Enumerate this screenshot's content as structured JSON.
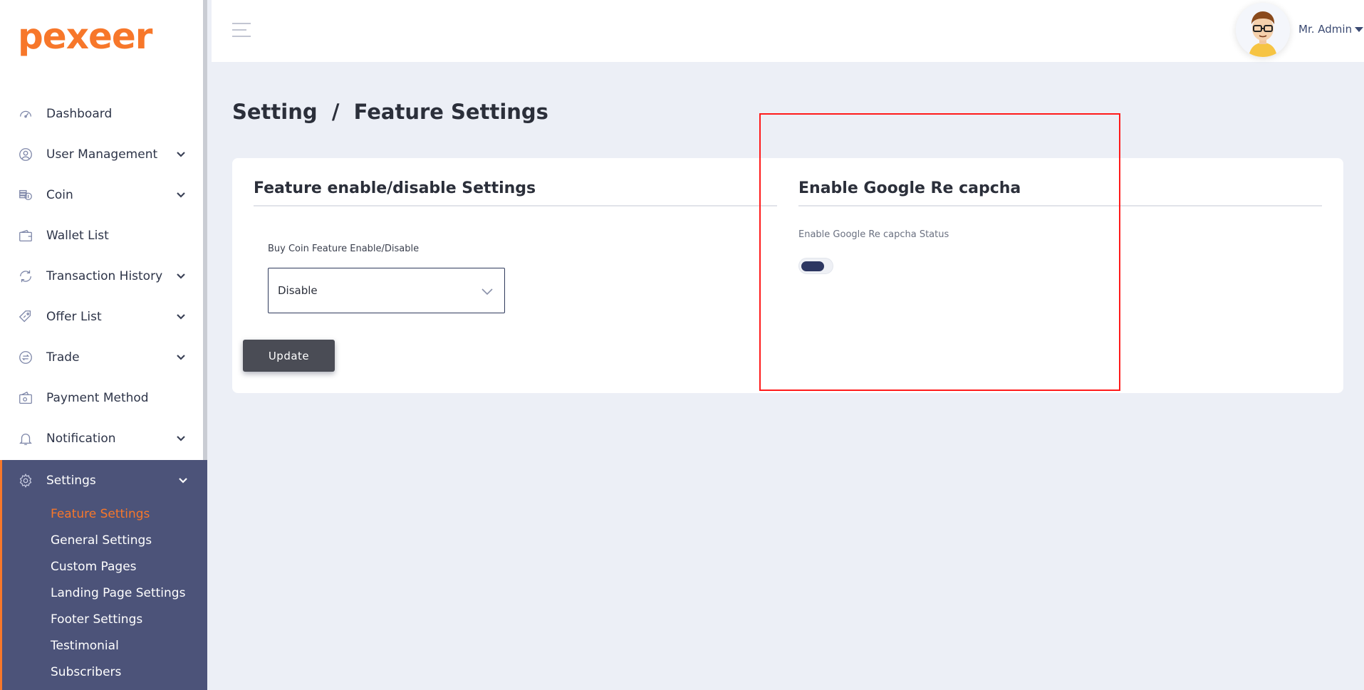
{
  "brand": {
    "logo_text": "pexeer",
    "accent_color": "#f7772a",
    "sidebar_active_bg": "#4c5379"
  },
  "sidebar": {
    "items": [
      {
        "label": "Dashboard",
        "icon": "dashboard-gauge-icon",
        "has_children": false
      },
      {
        "label": "User Management",
        "icon": "user-circle-icon",
        "has_children": true
      },
      {
        "label": "Coin",
        "icon": "coin-stack-icon",
        "has_children": true
      },
      {
        "label": "Wallet List",
        "icon": "wallet-icon",
        "has_children": false
      },
      {
        "label": "Transaction History",
        "icon": "transaction-history-icon",
        "has_children": true
      },
      {
        "label": "Offer List",
        "icon": "offer-tag-icon",
        "has_children": true
      },
      {
        "label": "Trade",
        "icon": "trade-exchange-icon",
        "has_children": true
      },
      {
        "label": "Payment Method",
        "icon": "payment-wallet-icon",
        "has_children": false
      },
      {
        "label": "Notification",
        "icon": "bell-icon",
        "has_children": true
      }
    ],
    "active_section": {
      "label": "Settings",
      "icon": "gear-icon",
      "children": [
        "Feature Settings",
        "General Settings",
        "Custom Pages",
        "Landing Page Settings",
        "Footer Settings",
        "Testimonial",
        "Subscribers"
      ],
      "current_child": "Feature Settings"
    }
  },
  "topbar": {
    "user_name": "Mr. Admin"
  },
  "page": {
    "title": "Setting  /  Feature Settings"
  },
  "feature_panel": {
    "title": "Feature enable/disable Settings",
    "field_label": "Buy Coin Feature Enable/Disable",
    "select_value": "Disable",
    "button_label": "Update"
  },
  "recaptcha_panel": {
    "title": "Enable Google Re capcha",
    "field_label": "Enable Google Re capcha Status",
    "toggle_on": true
  }
}
